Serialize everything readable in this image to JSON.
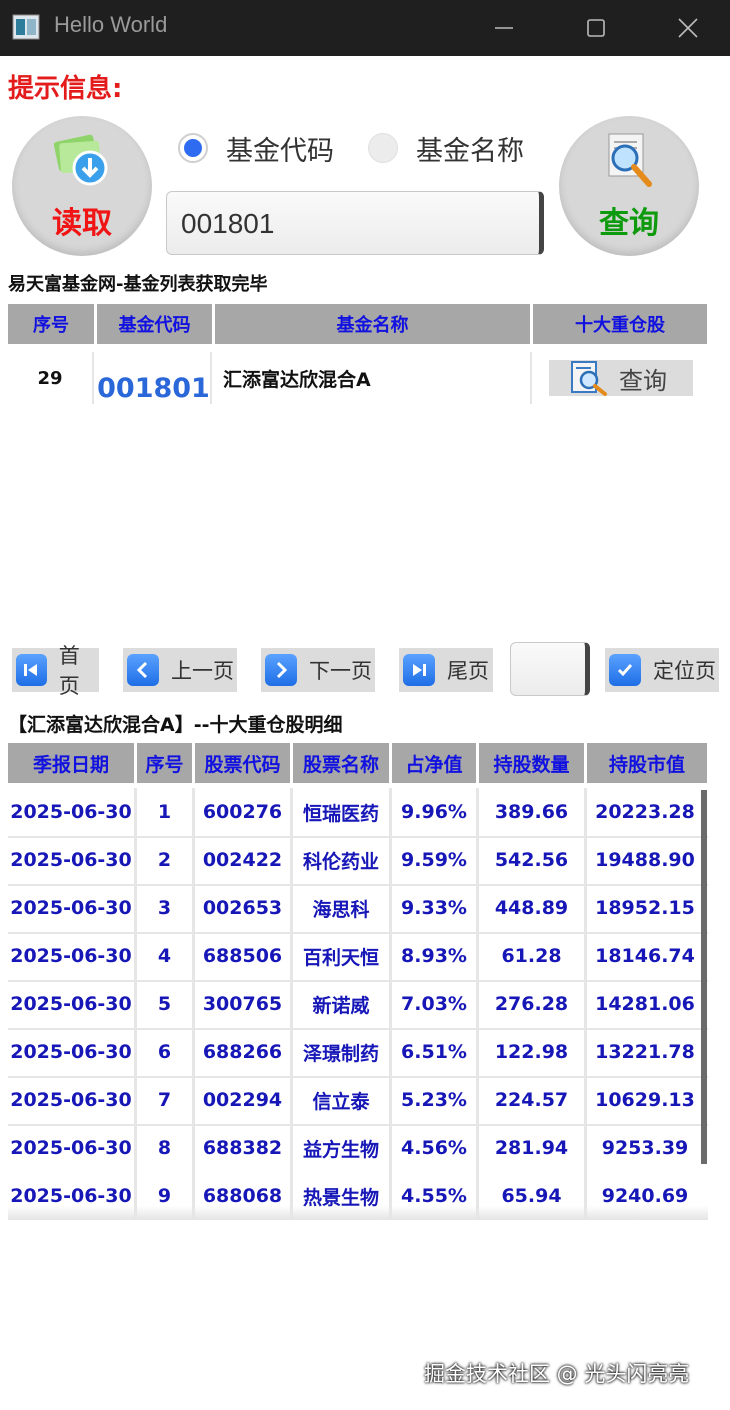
{
  "window": {
    "title": "Hello World"
  },
  "hint_label": "提示信息:",
  "buttons": {
    "read": "读取",
    "query": "查询"
  },
  "search": {
    "radio_code": "基金代码",
    "radio_name": "基金名称",
    "selected": "基金代码",
    "value": "001801"
  },
  "status": "易天富基金网-基金列表获取完毕",
  "fund_grid": {
    "columns": [
      "序号",
      "基金代码",
      "基金名称",
      "十大重仓股"
    ],
    "rows": [
      {
        "index": "29",
        "code": "001801",
        "name": "汇添富达欣混合A",
        "action": "查询"
      }
    ]
  },
  "pager": {
    "first": "首页",
    "prev": "上一页",
    "next": "下一页",
    "last": "尾页",
    "page_value": "",
    "locate": "定位页"
  },
  "detail": {
    "title": "【汇添富达欣混合A】--十大重仓股明细",
    "columns": [
      "季报日期",
      "序号",
      "股票代码",
      "股票名称",
      "占净值",
      "持股数量",
      "持股市值"
    ],
    "rows": [
      [
        "2025-06-30",
        "1",
        "600276",
        "恒瑞医药",
        "9.96%",
        "389.66",
        "20223.28"
      ],
      [
        "2025-06-30",
        "2",
        "002422",
        "科伦药业",
        "9.59%",
        "542.56",
        "19488.90"
      ],
      [
        "2025-06-30",
        "3",
        "002653",
        "海思科",
        "9.33%",
        "448.89",
        "18952.15"
      ],
      [
        "2025-06-30",
        "4",
        "688506",
        "百利天恒",
        "8.93%",
        "61.28",
        "18146.74"
      ],
      [
        "2025-06-30",
        "5",
        "300765",
        "新诺威",
        "7.03%",
        "276.28",
        "14281.06"
      ],
      [
        "2025-06-30",
        "6",
        "688266",
        "泽璟制药",
        "6.51%",
        "122.98",
        "13221.78"
      ],
      [
        "2025-06-30",
        "7",
        "002294",
        "信立泰",
        "5.23%",
        "224.57",
        "10629.13"
      ],
      [
        "2025-06-30",
        "8",
        "688382",
        "益方生物",
        "4.56%",
        "281.94",
        "9253.39"
      ],
      [
        "2025-06-30",
        "9",
        "688068",
        "热景生物",
        "4.55%",
        "65.94",
        "9240.69"
      ]
    ]
  },
  "watermark": "掘金技术社区 @ 光头闪亮亮",
  "colors": {
    "header_bg": "#a7a7a7",
    "header_text": "#1212e0",
    "cell_text": "#1717b8",
    "hint": "#e31b1b",
    "query": "#0d9a0d"
  }
}
